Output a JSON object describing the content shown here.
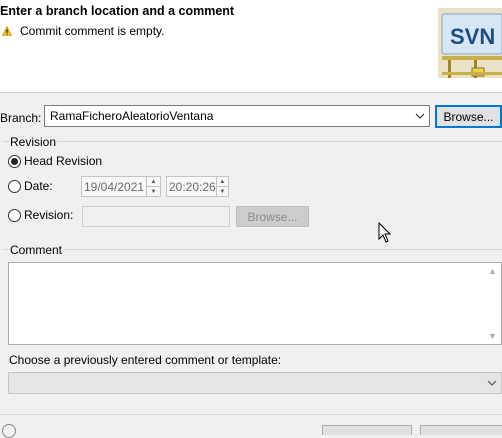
{
  "banner": {
    "title": "Enter a branch location and a comment",
    "warning": "Commit comment is empty.",
    "warning_icon": "warning-icon",
    "logo_text": "SVN"
  },
  "branch": {
    "label": "Branch:",
    "value": "RamaFicheroAleatorioVentana",
    "browse_label": "Browse..."
  },
  "revision": {
    "group_label": "Revision",
    "head_label": "Head Revision",
    "head_selected": true,
    "date_label": "Date:",
    "date_value": "19/04/2021",
    "time_value": "20:20:26",
    "revision_label": "Revision:",
    "revision_value": "",
    "browse_label": "Browse..."
  },
  "comment": {
    "group_label": "Comment",
    "text": "",
    "template_label": "Choose a previously entered comment or template:",
    "template_value": ""
  },
  "colors": {
    "focus_border": "#0078d7",
    "banner_bg": "#ffffff",
    "dialog_bg": "#f0f0f0"
  }
}
